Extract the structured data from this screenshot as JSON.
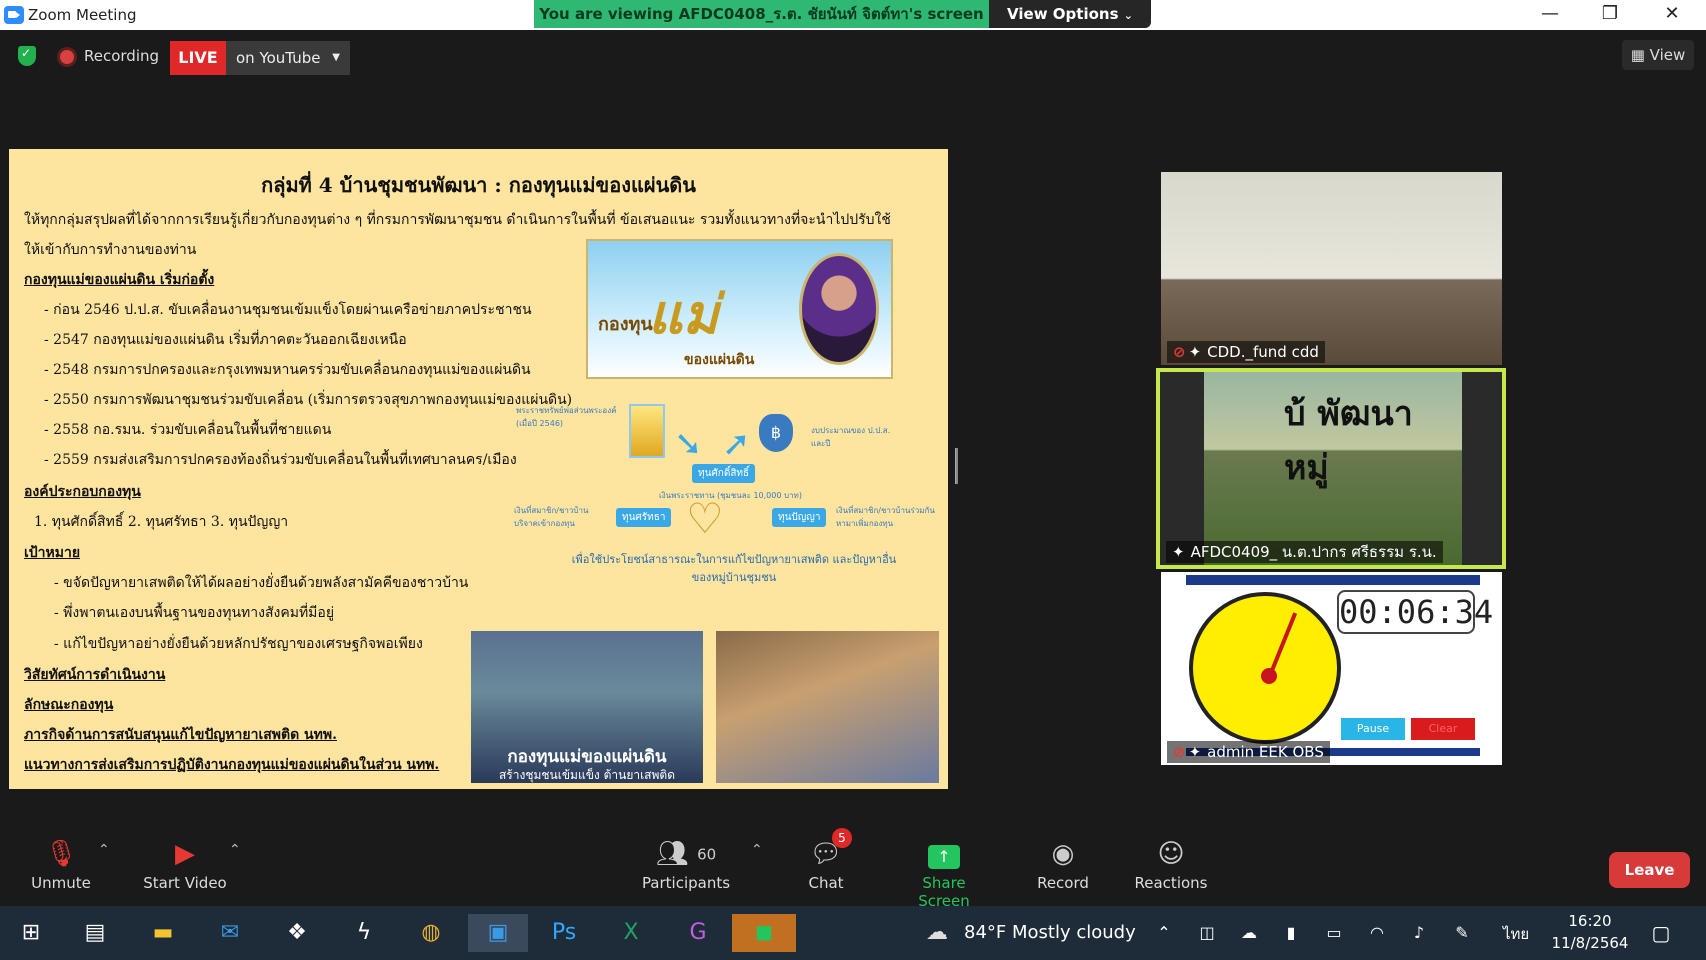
{
  "window": {
    "title": "Zoom Meeting",
    "viewing_banner": "You are viewing AFDC0408_ร.ต. ชัยนันท์ จิตต์ทา's screen",
    "view_options": "View Options"
  },
  "topbar": {
    "recording_label": "Recording",
    "live_label": "LIVE",
    "live_target": "on YouTube",
    "view_label": "View"
  },
  "slide": {
    "title": "กลุ่มที่ 4 บ้านชุมชนพัฒนา : กองทุนแม่ของแผ่นดิน",
    "intro_line1": "ให้ทุกกลุ่มสรุปผลที่ได้จากการเรียนรู้เกี่ยวกับกองทุนต่าง ๆ ที่กรมการพัฒนาชุมชน ดำเนินการในพื้นที่ ข้อเสนอแนะ รวมทั้งแนวทางที่จะนำไปปรับใช้",
    "intro_line2": "ให้เข้ากับการทำงานของท่าน",
    "heading_history": "กองทุนแม่ของแผ่นดิน เริ่มก่อตั้ง",
    "history": [
      "-   ก่อน 2546 ป.ป.ส. ขับเคลื่อนงานชุมชนเข้มแข็งโดยผ่านเครือข่ายภาคประชาชน",
      "-   2547 กองทุนแม่ของแผ่นดิน เริ่มที่ภาคตะวันออกเฉียงเหนือ",
      "-   2548 กรมการปกครองและกรุงเทพมหานครร่วมขับเคลื่อนกองทุนแม่ของแผ่นดิน",
      "-   2550 กรมการพัฒนาชุมชนร่วมขับเคลื่อน (เริ่มการตรวจสุขภาพกองทุนแม่ของแผ่นดิน)",
      "-   2558 กอ.รมน. ร่วมขับเคลื่อนในพื้นที่ชายแดน",
      "-   2559 กรมส่งเสริมการปกครองท้องถิ่นร่วมขับเคลื่อนในพื้นที่เทศบาลนคร/เมือง"
    ],
    "heading_components": "องค์ประกอบกองทุน",
    "components": "1. ทุนศักดิ์สิทธิ์     2. ทุนศรัทธา      3. ทุนปัญญา",
    "heading_goals": "เป้าหมาย",
    "goals": [
      "- ขจัดปัญหายาเสพติดให้ได้ผลอย่างยั่งยืนด้วยพลังสามัคคีของชาวบ้าน",
      "- พึ่งพาตนเองบนพื้นฐานของทุนทางสังคมที่มีอยู่",
      "- แก้ไขปัญหาอย่างยั่งยืนด้วยหลักปรัชญาของเศรษฐกิจพอเพียง"
    ],
    "heading_vision": "วิสัยทัศน์การดำเนินงาน",
    "heading_nature": "ลักษณะกองทุน",
    "heading_mission": "ภารกิจด้านการสนับสนุนแก้ไขปัญหายาเสพติด นทพ.",
    "heading_guideline": "แนวทางการส่งเสริมการปฏิบัติงานกองทุนแม่ของแผ่นดินในส่วน นทพ.",
    "banner_logo": "กองทุน",
    "banner_big": "แม่",
    "banner_sub": "ของแผ่นดิน",
    "diagram": {
      "left_note": "พระราชทรัพย์พ่อส่วนพระองค์ (เมื่อปี 2546)",
      "right_note": "งบประมาณของ ป.ป.ส. และปี",
      "box_center": "ทุนศักดิ์สิทธิ์",
      "center_note": "เงินพระราชทาน (ชุมชนละ 10,000 บาท)",
      "box_left": "ทุนศรัทธา",
      "left_note2": "เงินที่สมาชิก/ชาวบ้าน บริจาคเข้ากองทุน",
      "box_right": "ทุนปัญญา",
      "right_note2": "เงินที่สมาชิก/ชาวบ้านร่วมกัน หามาเพิ่มกองทุน",
      "caption_line1": "เพื่อใช้ประโยชน์สาธารณะในการแก้ไขปัญหายาเสพติด และปัญหาอื่น",
      "caption_line2": "ของหมู่บ้านชุมชน"
    },
    "photo_caption1": "กองทุนแม่ของแผ่นดิน",
    "photo_caption2": "สร้างชุมชนเข้มแข็ง ต้านยาเสพติด"
  },
  "participants": [
    {
      "name": "CDD._fund cdd",
      "muted": true
    },
    {
      "name": "AFDC0409_ น.ต.ปากร ศรีธรรม ร.น.",
      "muted": false,
      "overlay": "บ้ พัฒนา หมู่"
    },
    {
      "name": "admin EEK OBS",
      "muted": true,
      "timer": "00:06:34",
      "pause": "Pause",
      "clear": "Clear"
    }
  ],
  "toolbar": {
    "unmute": "Unmute",
    "start_video": "Start Video",
    "participants": "Participants",
    "participants_count": "60",
    "chat": "Chat",
    "chat_badge": "5",
    "share_screen": "Share Screen",
    "record": "Record",
    "reactions": "Reactions",
    "leave": "Leave",
    "colors": {
      "share_screen": "#22c55e",
      "leave": "#d83a3a"
    }
  },
  "taskbar": {
    "temperature": "84°F",
    "weather": "Mostly cloudy",
    "language": "ไทย",
    "time": "16:20",
    "date": "11/8/2564"
  }
}
